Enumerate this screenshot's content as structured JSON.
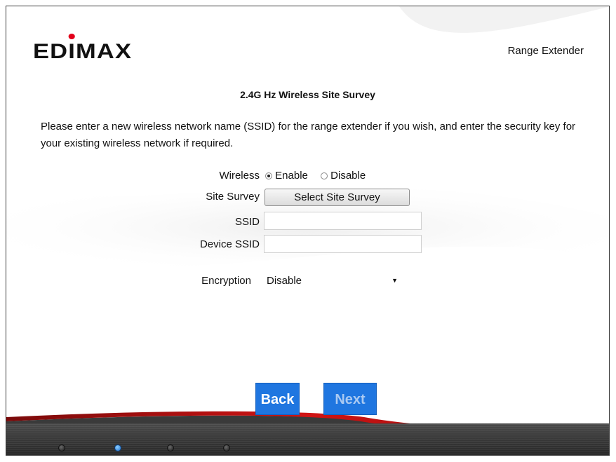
{
  "header": {
    "brand_logo": "EDIMAX",
    "product_name": "Range Extender"
  },
  "page": {
    "title": "2.4G Hz  Wireless Site Survey",
    "instructions": "Please enter a new wireless network name (SSID) for the range extender if you wish, and enter the security key for your existing wireless network if required."
  },
  "form": {
    "wireless_label": "Wireless",
    "wireless_enable_label": "Enable",
    "wireless_disable_label": "Disable",
    "wireless_selected": "Enable",
    "site_survey_label": "Site Survey",
    "site_survey_button": "Select Site Survey",
    "ssid_label": "SSID",
    "ssid_value": "",
    "device_ssid_label": "Device SSID",
    "device_ssid_value": "",
    "encryption_label": "Encryption",
    "encryption_value": "Disable"
  },
  "nav": {
    "back_label": "Back",
    "next_label": "Next"
  },
  "progress": {
    "total_steps": 4,
    "current_step": 2
  },
  "colors": {
    "brand_red": "#e2001a",
    "button_blue": "#1f76e0",
    "active_dot": "#1d6fcf"
  }
}
